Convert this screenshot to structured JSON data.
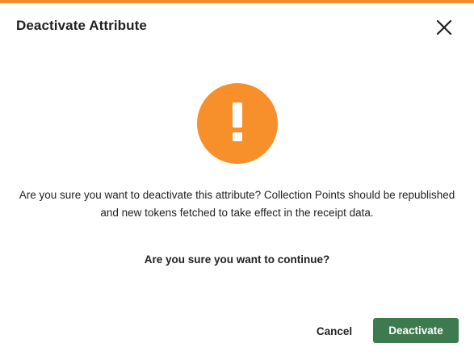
{
  "dialog": {
    "title": "Deactivate Attribute",
    "close_icon": "close-icon",
    "warning_icon": "exclamation-icon",
    "message": "Are you sure you want to deactivate this attribute? Collection Points should be republished and new tokens fetched to take effect in the receipt data.",
    "confirm_text": "Are you sure you want to continue?",
    "cancel_label": "Cancel",
    "deactivate_label": "Deactivate"
  },
  "colors": {
    "accent": "#f28c28",
    "warning": "#f7902a",
    "primary_button": "#3e7a4f"
  }
}
